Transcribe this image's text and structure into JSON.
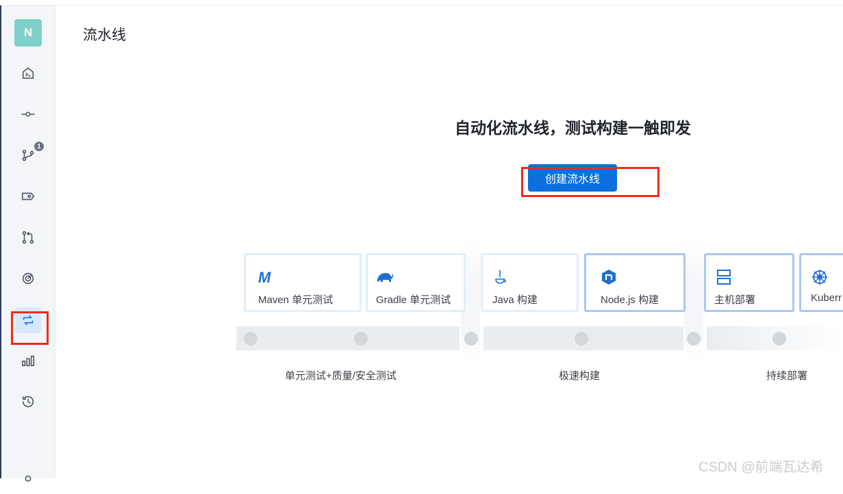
{
  "sidebar": {
    "avatar_letter": "N",
    "items": [
      {
        "name": "home-icon"
      },
      {
        "name": "commit-icon"
      },
      {
        "name": "branch-icon",
        "badge": "1"
      },
      {
        "name": "tag-icon"
      },
      {
        "name": "merge-request-icon"
      },
      {
        "name": "code-scan-icon"
      },
      {
        "name": "pipeline-icon",
        "active": true
      },
      {
        "name": "stats-icon"
      },
      {
        "name": "history-icon"
      },
      {
        "name": "user-icon"
      }
    ]
  },
  "page": {
    "title": "流水线",
    "headline": "自动化流水线，测试构建一触即发",
    "create_button": "创建流水线"
  },
  "cards": [
    {
      "icon": "maven-icon",
      "label": "Maven 单元测试"
    },
    {
      "icon": "gradle-icon",
      "label": "Gradle 单元测试"
    },
    {
      "icon": "java-icon",
      "label": "Java 构建"
    },
    {
      "icon": "nodejs-icon",
      "label": "Node.js 构建"
    },
    {
      "icon": "server-icon",
      "label": "主机部署"
    },
    {
      "icon": "kubernetes-icon",
      "label": "Kuberr"
    }
  ],
  "stages": [
    {
      "label": "单元测试+质量/安全测试"
    },
    {
      "label": "极速构建"
    },
    {
      "label": "持续部署"
    }
  ],
  "colors": {
    "accent": "#0b6fde",
    "highlight": "#f02a1a",
    "sidebar_bg": "#f3f5f8"
  },
  "watermark": "CSDN @前端瓦达希"
}
